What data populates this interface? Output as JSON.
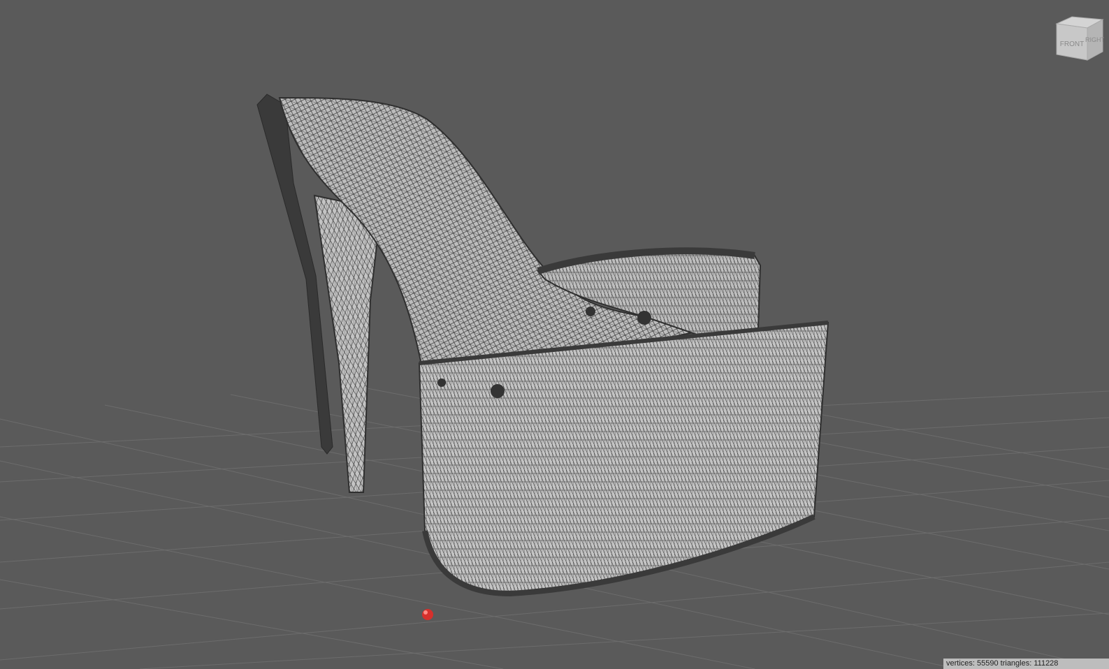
{
  "viewport": {
    "background": "#5a5a5a",
    "grid_color": "#6c6c6c",
    "model_fill": "#bfbfbf",
    "model_wire": "#303030",
    "marker_color": "#e0312f"
  },
  "view_cube": {
    "front_label": "FRONT",
    "right_label": "RIGHT",
    "icon": "view-cube-icon"
  },
  "status": {
    "text": "vertices: 55590 triangles: 111228"
  }
}
